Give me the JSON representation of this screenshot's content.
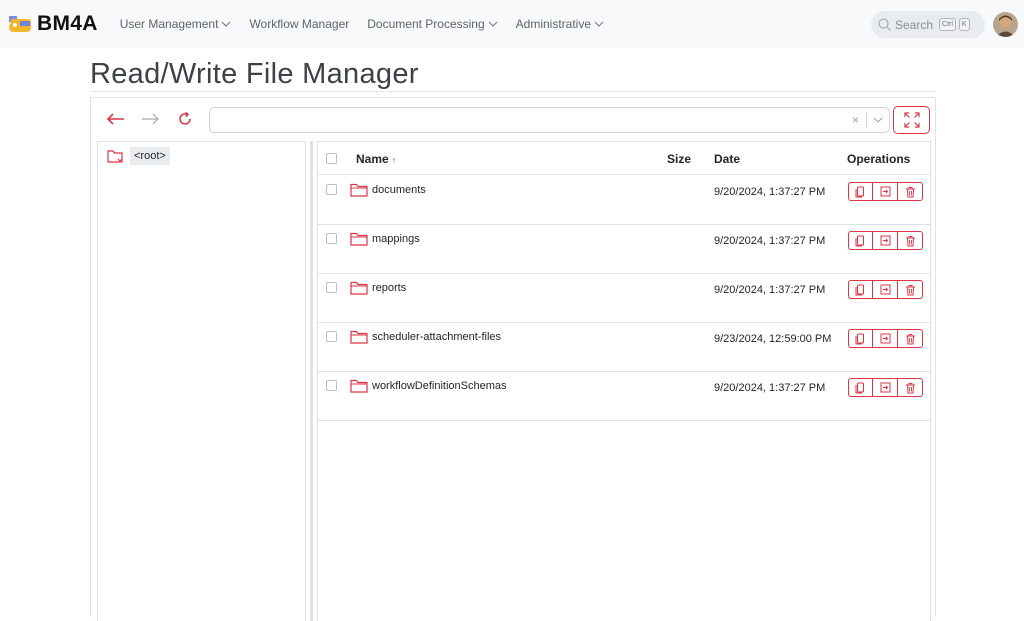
{
  "brand": {
    "name": "BM4A"
  },
  "nav": {
    "items": [
      {
        "label": "User Management",
        "has_dropdown": true
      },
      {
        "label": "Workflow Manager",
        "has_dropdown": false
      },
      {
        "label": "Document Processing",
        "has_dropdown": true
      },
      {
        "label": "Administrative",
        "has_dropdown": true
      }
    ],
    "search": {
      "label": "Search",
      "keys": [
        "Ctrl",
        "K"
      ],
      "icon": "search-icon"
    },
    "avatar": "user-avatar"
  },
  "page": {
    "title": "Read/Write File Manager"
  },
  "toolbar": {
    "back_icon": "arrow-left-icon",
    "forward_icon": "arrow-right-icon",
    "refresh_icon": "refresh-icon",
    "path_value": "",
    "clear_label": "×",
    "expand_icon": "expand-icon"
  },
  "tree": {
    "root_label": "<root>"
  },
  "list": {
    "columns": {
      "name": "Name",
      "sort_indicator": "↑",
      "size": "Size",
      "date": "Date",
      "operations": "Operations"
    },
    "rows": [
      {
        "name": "documents",
        "size": "",
        "date": "9/20/2024, 1:37:27 PM"
      },
      {
        "name": "mappings",
        "size": "",
        "date": "9/20/2024, 1:37:27 PM"
      },
      {
        "name": "reports",
        "size": "",
        "date": "9/20/2024, 1:37:27 PM"
      },
      {
        "name": "scheduler-attachment-files",
        "size": "",
        "date": "9/23/2024, 12:59:00 PM"
      },
      {
        "name": "workflowDefinitionSchemas",
        "size": "",
        "date": "9/20/2024, 1:37:27 PM"
      }
    ],
    "operation_icons": [
      "copy-icon",
      "move-icon",
      "trash-icon"
    ]
  },
  "colors": {
    "accent": "#dc3545",
    "navbar_bg": "#f8f9fa",
    "border": "#dee2e6"
  }
}
